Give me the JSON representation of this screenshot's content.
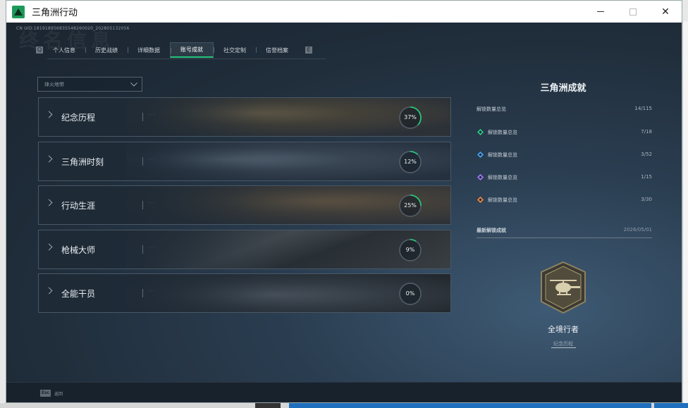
{
  "window": {
    "title": "三角洲行动"
  },
  "header": {
    "uid": "CN UID:181918956835548260020_202805132056",
    "bg_word": "终名信息"
  },
  "tabs": [
    {
      "label": "个人信息",
      "active": false
    },
    {
      "label": "历史战绩",
      "active": false
    },
    {
      "label": "详细数据",
      "active": false
    },
    {
      "label": "账号成就",
      "active": true
    },
    {
      "label": "社交定制",
      "active": false
    },
    {
      "label": "信誉档案",
      "active": false
    }
  ],
  "tab_nav": {
    "prev": "Q",
    "next": "E"
  },
  "filter": {
    "value": "烽火地带"
  },
  "categories": [
    {
      "label": "纪念历程",
      "percent": 37,
      "percent_text": "37%",
      "dots": "· · ·"
    },
    {
      "label": "三角洲时刻",
      "percent": 12,
      "percent_text": "12%",
      "dots": "· · ·"
    },
    {
      "label": "行动生涯",
      "percent": 25,
      "percent_text": "25%",
      "dots": "· · ·"
    },
    {
      "label": "枪械大师",
      "percent": 9,
      "percent_text": "9%",
      "dots": "· · ·"
    },
    {
      "label": "全能干员",
      "percent": 0,
      "percent_text": "0%",
      "dots": "· · ·"
    }
  ],
  "summary": {
    "title": "三角洲成就",
    "total": {
      "label": "解锁数量总览",
      "value": "14/115"
    },
    "tiers": [
      {
        "label": "解锁数量总览",
        "value": "7/18",
        "color": "#2ecf8a",
        "icon": "green-tier-icon"
      },
      {
        "label": "解锁数量总览",
        "value": "3/52",
        "color": "#4aa6ff",
        "icon": "blue-tier-icon"
      },
      {
        "label": "解锁数量总览",
        "value": "1/15",
        "color": "#a77bff",
        "icon": "purple-tier-icon"
      },
      {
        "label": "解锁数量总览",
        "value": "3/30",
        "color": "#ff8a3d",
        "icon": "orange-tier-icon"
      }
    ],
    "latest": {
      "label": "最新解锁成就",
      "date": "2026/05/01"
    },
    "badge": {
      "name": "全境行者",
      "category": "纪念历程",
      "icon": "helicopter-badge-icon"
    }
  },
  "footer": {
    "esc_key": "Esc",
    "esc_label": "返回"
  },
  "colors": {
    "accent": "#27c47a",
    "ring_track": "#55616c"
  }
}
